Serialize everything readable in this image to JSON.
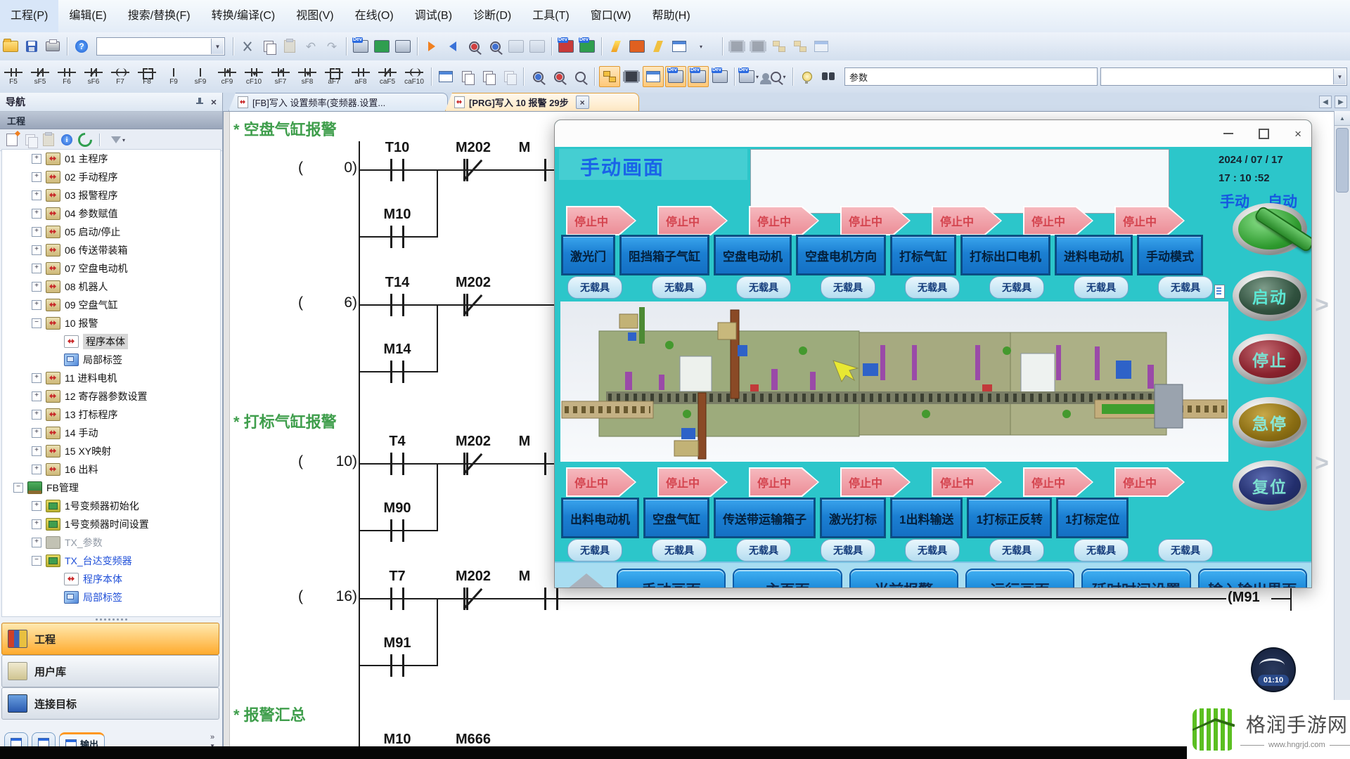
{
  "icons": {
    "dev": "Dev",
    "q": "?",
    "caret": "▼",
    "scaret": "▾",
    "close": "×",
    "undo": "↶",
    "redo": "↷",
    "left_arrow": "◀",
    "right_arrow": "▶",
    "up_arrow": "▲",
    "chev_right": "»",
    "gt": ">",
    "plus": "+",
    "minus": "−"
  },
  "menu": {
    "items": [
      "工程(P)",
      "编辑(E)",
      "搜索/替换(F)",
      "转换/编译(C)",
      "视图(V)",
      "在线(O)",
      "调试(B)",
      "诊断(D)",
      "工具(T)",
      "窗口(W)",
      "帮助(H)"
    ]
  },
  "toolbar": {
    "params_value": "参数"
  },
  "ladder_toolbar": {
    "buttons": [
      {
        "key": "F5",
        "sym": "c"
      },
      {
        "key": "sF5",
        "sym": "nc"
      },
      {
        "key": "F6",
        "sym": "c"
      },
      {
        "key": "sF6",
        "sym": "nc"
      },
      {
        "key": "F7",
        "sym": "coil"
      },
      {
        "key": "F8",
        "sym": "brk"
      },
      {
        "key": "F9",
        "sym": "vl"
      },
      {
        "key": "sF9",
        "sym": "vl"
      },
      {
        "key": "cF9",
        "sym": "pu"
      },
      {
        "key": "cF10",
        "sym": "pd"
      },
      {
        "key": "sF7",
        "sym": "pu"
      },
      {
        "key": "sF8",
        "sym": "pd"
      },
      {
        "key": "aF7",
        "sym": "brk"
      },
      {
        "key": "aF8",
        "sym": "c"
      },
      {
        "key": "caF5",
        "sym": "nc"
      },
      {
        "key": "caF10",
        "sym": "coil"
      }
    ]
  },
  "nav": {
    "title": "导航",
    "section": "工程",
    "tree": [
      {
        "label": "01 主程序",
        "cls": "lvl1",
        "exp": "+",
        "icon": "prg"
      },
      {
        "label": "02 手动程序",
        "cls": "lvl1",
        "exp": "+",
        "icon": "prg"
      },
      {
        "label": "03 报警程序",
        "cls": "lvl1",
        "exp": "+",
        "icon": "prg"
      },
      {
        "label": "04 参数赋值",
        "cls": "lvl1",
        "exp": "+",
        "icon": "prg"
      },
      {
        "label": "05 启动/停止",
        "cls": "lvl1",
        "exp": "+",
        "icon": "prg"
      },
      {
        "label": "06 传送带装箱",
        "cls": "lvl1",
        "exp": "+",
        "icon": "prg"
      },
      {
        "label": "07 空盘电动机",
        "cls": "lvl1",
        "exp": "+",
        "icon": "prg"
      },
      {
        "label": "08 机器人",
        "cls": "lvl1",
        "exp": "+",
        "icon": "prg"
      },
      {
        "label": "09 空盘气缸",
        "cls": "lvl1",
        "exp": "+",
        "icon": "prg"
      },
      {
        "label": "10 报警",
        "cls": "lvl1",
        "exp": "−",
        "icon": "prg"
      },
      {
        "label": "程序本体",
        "cls": "lvl2 sel",
        "exp": "",
        "icon": "body"
      },
      {
        "label": "局部标签",
        "cls": "lvl2",
        "exp": "",
        "icon": "tag"
      },
      {
        "label": "11 进料电机",
        "cls": "lvl1",
        "exp": "+",
        "icon": "prg"
      },
      {
        "label": "12 寄存器参数设置",
        "cls": "lvl1",
        "exp": "+",
        "icon": "prg"
      },
      {
        "label": "13 打标程序",
        "cls": "lvl1",
        "exp": "+",
        "icon": "prg"
      },
      {
        "label": "14 手动",
        "cls": "lvl1",
        "exp": "+",
        "icon": "prg"
      },
      {
        "label": "15 XY映射",
        "cls": "lvl1",
        "exp": "+",
        "icon": "prg"
      },
      {
        "label": "16 出料",
        "cls": "lvl1",
        "exp": "+",
        "icon": "prg"
      },
      {
        "label": "FB管理",
        "cls": "lvl0",
        "exp": "−",
        "icon": "fbroot"
      },
      {
        "label": "1号变频器初始化",
        "cls": "lvl1",
        "exp": "+",
        "icon": "fb"
      },
      {
        "label": "1号变频器时间设置",
        "cls": "lvl1",
        "exp": "+",
        "icon": "fb"
      },
      {
        "label": "TX_参数",
        "cls": "lvl1 gray",
        "exp": "+",
        "icon": "fbgray"
      },
      {
        "label": "TX_台达变频器",
        "cls": "lvl1 blue",
        "exp": "−",
        "icon": "fb"
      },
      {
        "label": "程序本体",
        "cls": "lvl2 blue",
        "exp": "",
        "icon": "body"
      },
      {
        "label": "局部标签",
        "cls": "lvl2 blue",
        "exp": "",
        "icon": "tag"
      }
    ],
    "bottom_buttons": [
      {
        "label": "工程",
        "cls": "active",
        "icon": "proj"
      },
      {
        "label": "用户库",
        "cls": "",
        "icon": "lib"
      },
      {
        "label": "连接目标",
        "cls": "",
        "icon": "conn"
      }
    ],
    "output_tab": "输出"
  },
  "editor": {
    "tabs": {
      "fb": "[FB]写入 设置频率(变频器.设置...",
      "prg": "[PRG]写入 10 报警 29步"
    },
    "comment1": "* 空盘气缸报警",
    "comment2": "* 打标气缸报警",
    "comment3": "* 报警汇总",
    "paren": "(",
    "rungs": {
      "r0": {
        "num": "0)",
        "c1": "T10",
        "c2": "M202",
        "c3": "M",
        "branch": "M10"
      },
      "r6": {
        "num": "6)",
        "c1": "T14",
        "c2": "M202",
        "branch": "M14"
      },
      "r10": {
        "num": "10)",
        "c1": "T4",
        "c2": "M202",
        "c3": "M",
        "branch": "M90"
      },
      "r16": {
        "num": "16)",
        "c1": "T7",
        "c2": "M202",
        "c3": "M",
        "branch": "M91",
        "coil": "(M91"
      },
      "partial": {
        "c1": "M10",
        "c2": "M666"
      }
    }
  },
  "hmi": {
    "title": "手动画面",
    "date": "2024 / 07 / 17",
    "time": "17  :  10   :52",
    "mode_manual": "手动",
    "mode_auto": "自动",
    "status_badge": "停止中",
    "carrier_badge": "无载具",
    "top_buttons": [
      "激光门",
      "阻挡箱子气缸",
      "空盘电动机",
      "空盘电机方向",
      "打标气缸",
      "打标出口电机",
      "进料电动机",
      "手动模式"
    ],
    "bottom_buttons": [
      "出料电动机",
      "空盘气缸",
      "传送带运输箱子",
      "激光打标",
      "1出料输送",
      "1打标正反转",
      "1打标定位"
    ],
    "nav_buttons": [
      "手动画面",
      "主页面",
      "当前报警",
      "运行画面",
      "延时时间设置",
      "输入输出界面"
    ],
    "side_buttons": {
      "start": "启动",
      "stop": "停止",
      "estop": "急停",
      "reset": "复位"
    }
  },
  "overlay": {
    "timer": "01:10",
    "brand": "格润手游网",
    "brand_url": "www.hngrjd.com"
  }
}
